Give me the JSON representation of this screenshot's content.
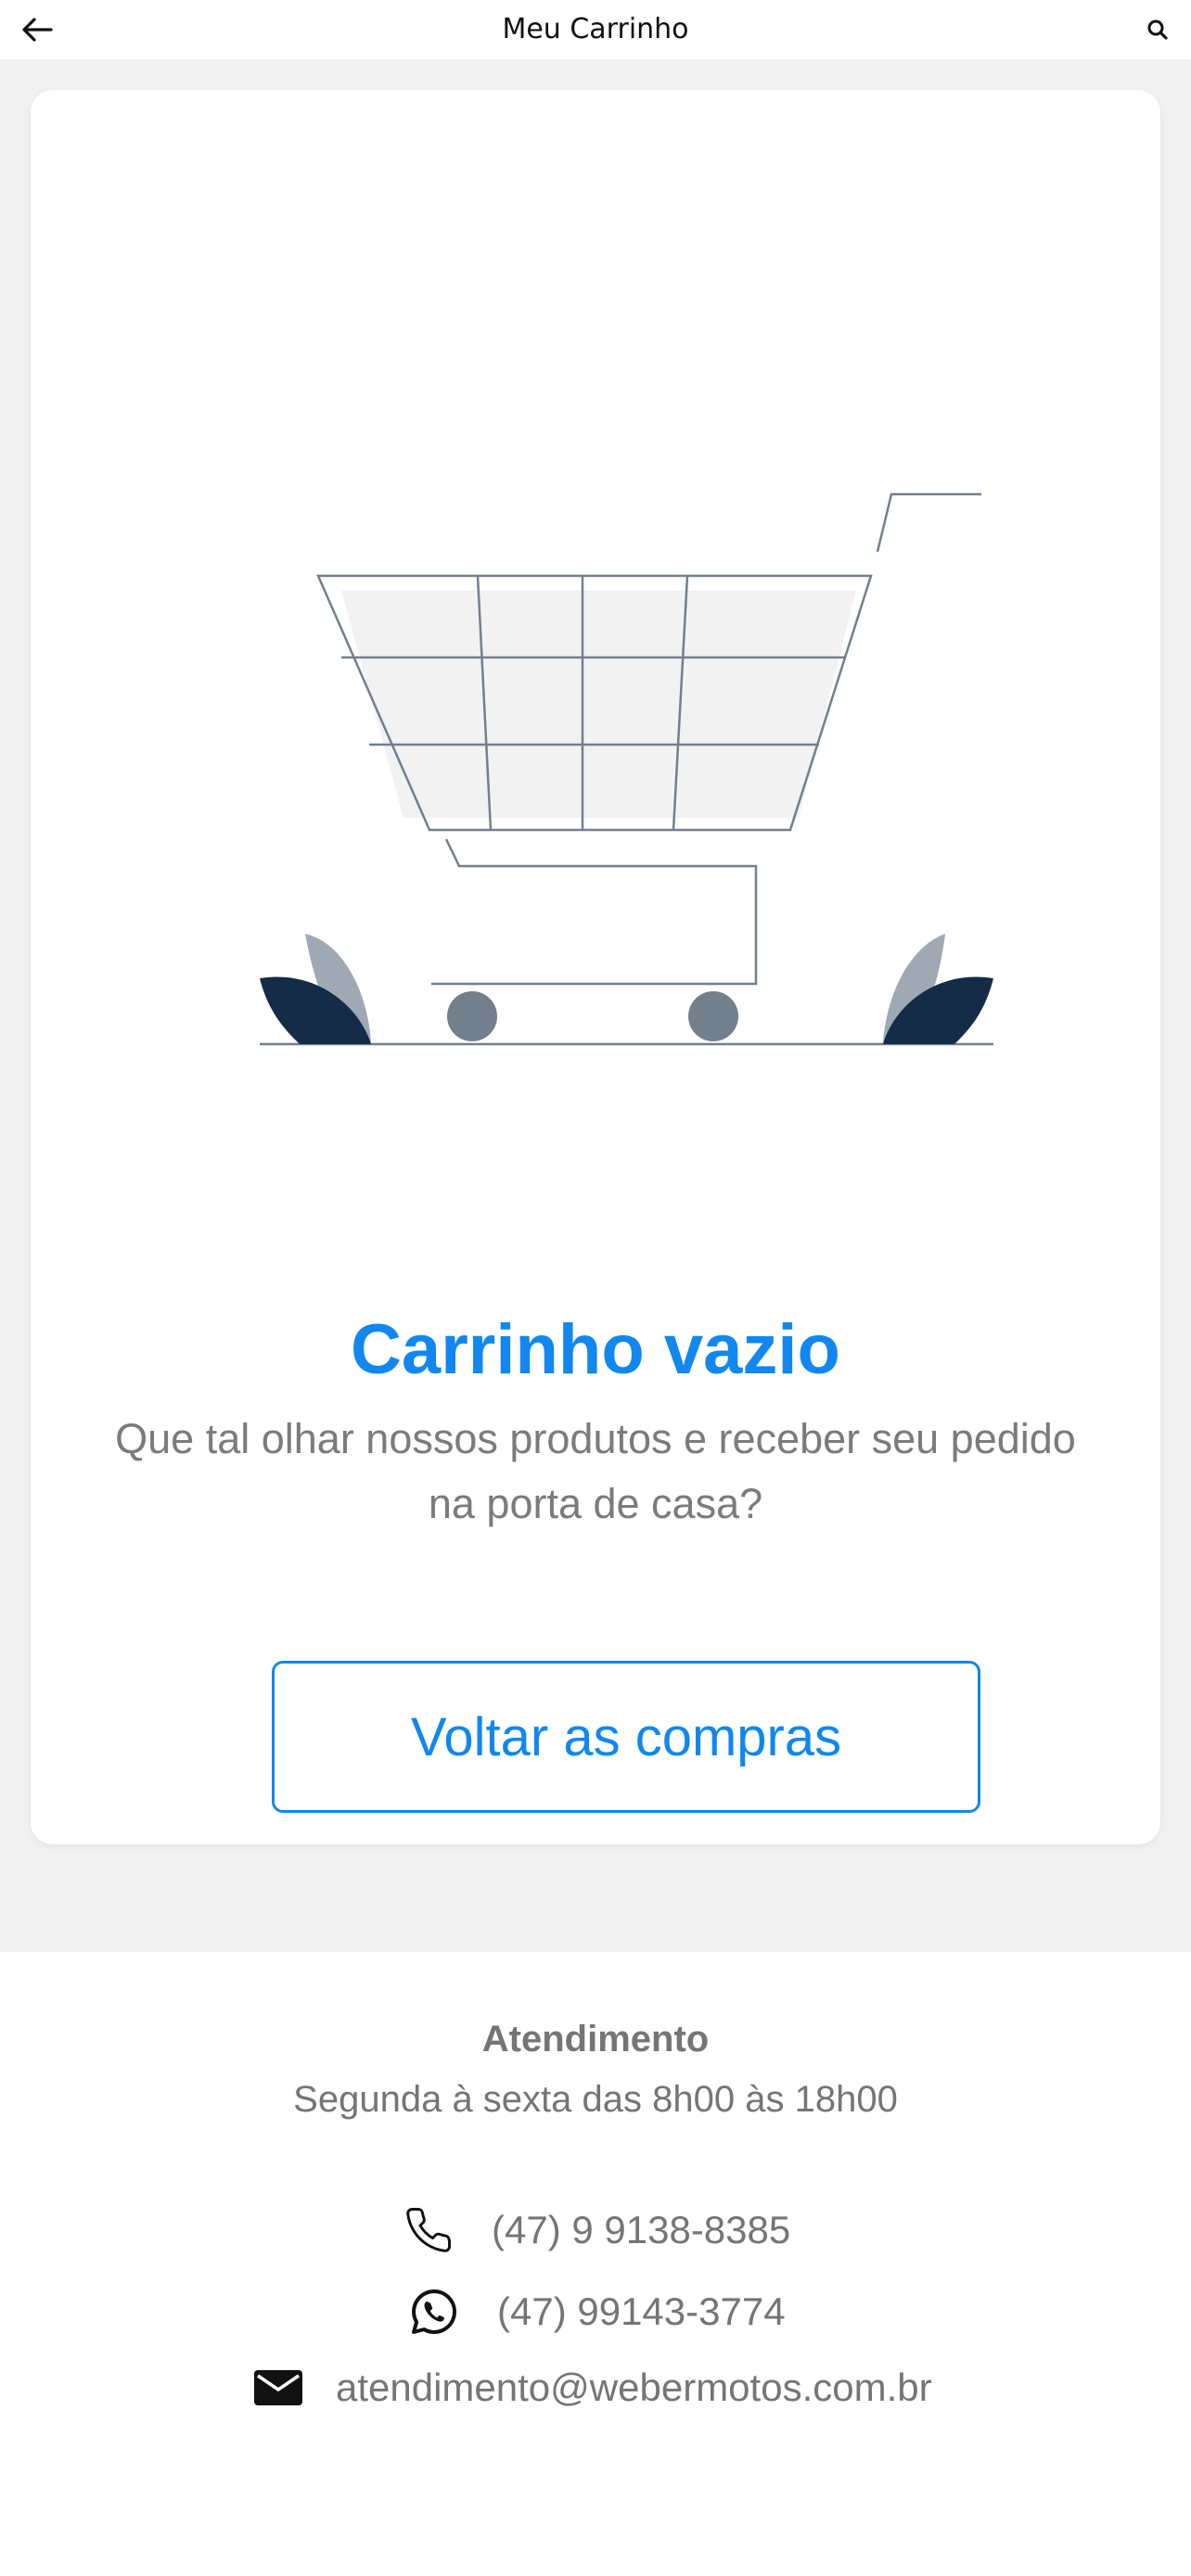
{
  "header": {
    "title": "Meu Carrinho",
    "back_icon": "arrow-left-icon",
    "search_icon": "search-icon"
  },
  "empty_state": {
    "illustration": "empty-cart-illustration",
    "title": "Carrinho vazio",
    "description": "Que tal olhar nossos produtos e receber seu pedido na porta de casa?",
    "cta_label": "Voltar as compras"
  },
  "footer": {
    "title": "Atendimento",
    "hours": "Segunda à sexta das 8h00 às 18h00",
    "contacts": [
      {
        "icon": "phone-icon",
        "text": "(47) 9 9138-8385"
      },
      {
        "icon": "whatsapp-icon",
        "text": "(47) 99143-3774"
      },
      {
        "icon": "envelope-icon",
        "text": "atendimento@webermotos.com.br"
      }
    ]
  },
  "colors": {
    "accent": "#1187ef",
    "text_muted": "#757575",
    "background": "#f1f1f1",
    "leaf_dark": "#142c48",
    "leaf_light": "#a0a9b3",
    "wheel": "#737f8d"
  }
}
